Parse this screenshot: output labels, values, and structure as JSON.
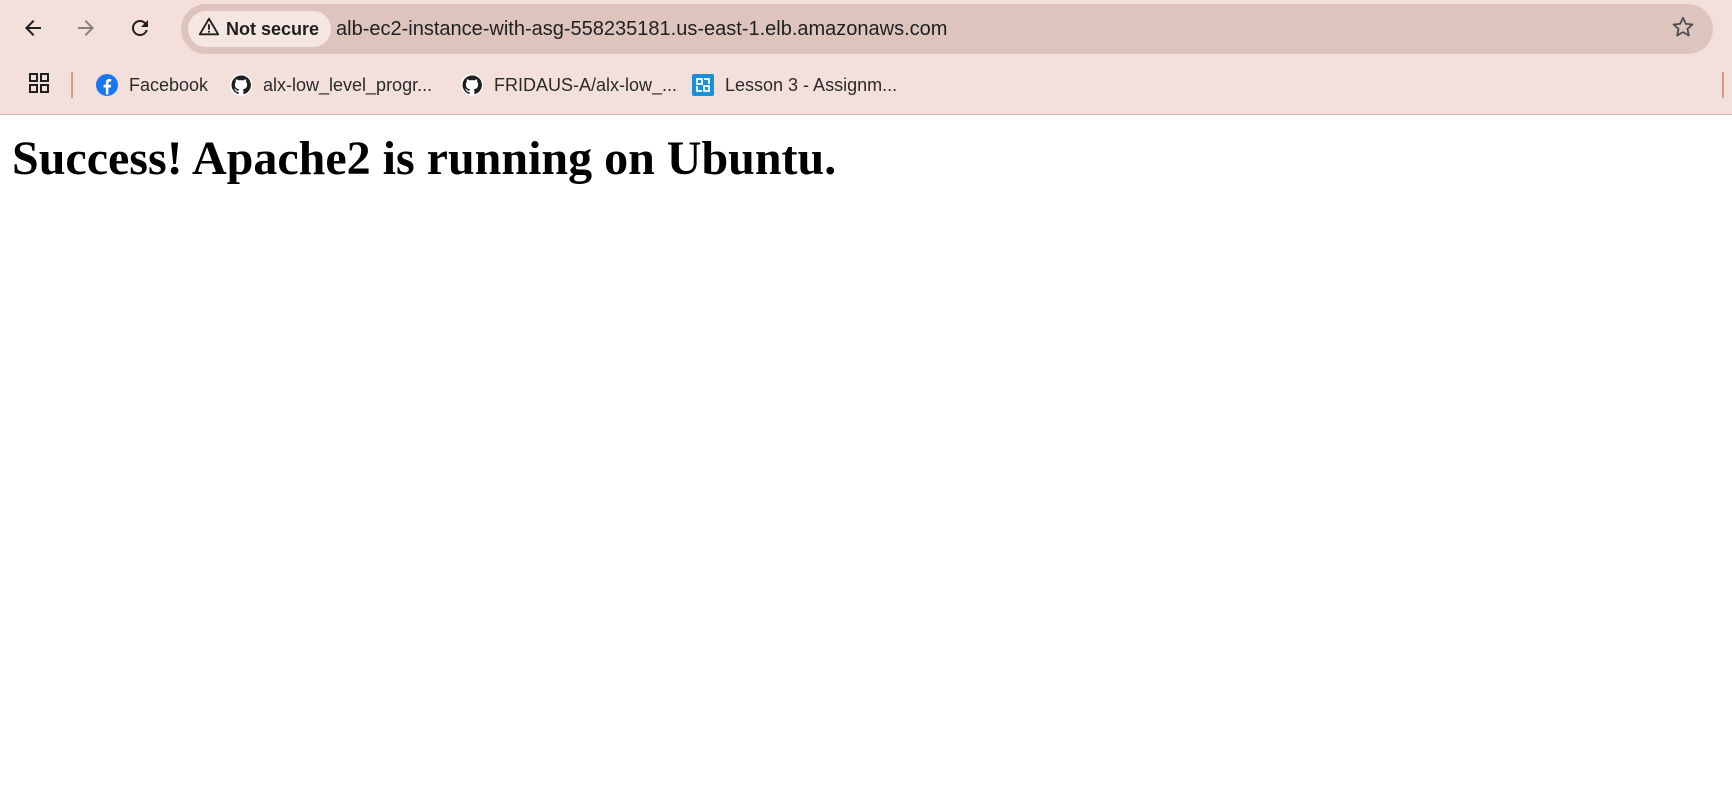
{
  "toolbar": {
    "back_icon": "arrow-left-icon",
    "forward_icon": "arrow-right-icon",
    "reload_icon": "reload-icon"
  },
  "omnibox": {
    "security_icon": "warning-triangle-icon",
    "security_label": "Not secure",
    "url": "alb-ec2-instance-with-asg-558235181.us-east-1.elb.amazonaws.com",
    "bookmark_star_icon": "star-outline-icon"
  },
  "bookmarks": {
    "apps_icon": "apps-grid-icon",
    "items": [
      {
        "label": "Facebook",
        "icon": "facebook-icon"
      },
      {
        "label": "alx-low_level_progr...",
        "icon": "github-icon"
      },
      {
        "label": "FRIDAUS-A/alx-low_...",
        "icon": "github-icon"
      },
      {
        "label": "Lesson 3 - Assignm...",
        "icon": "lesson-app-icon"
      }
    ]
  },
  "page": {
    "heading": "Success! Apache2 is running on Ubuntu."
  },
  "colors": {
    "chrome_bg": "#f4e0db",
    "omnibox_bg": "#ddc5be",
    "chip_bg": "#f6e6e2",
    "facebook_blue": "#1877f2",
    "lesson_blue": "#1a8fd6"
  }
}
